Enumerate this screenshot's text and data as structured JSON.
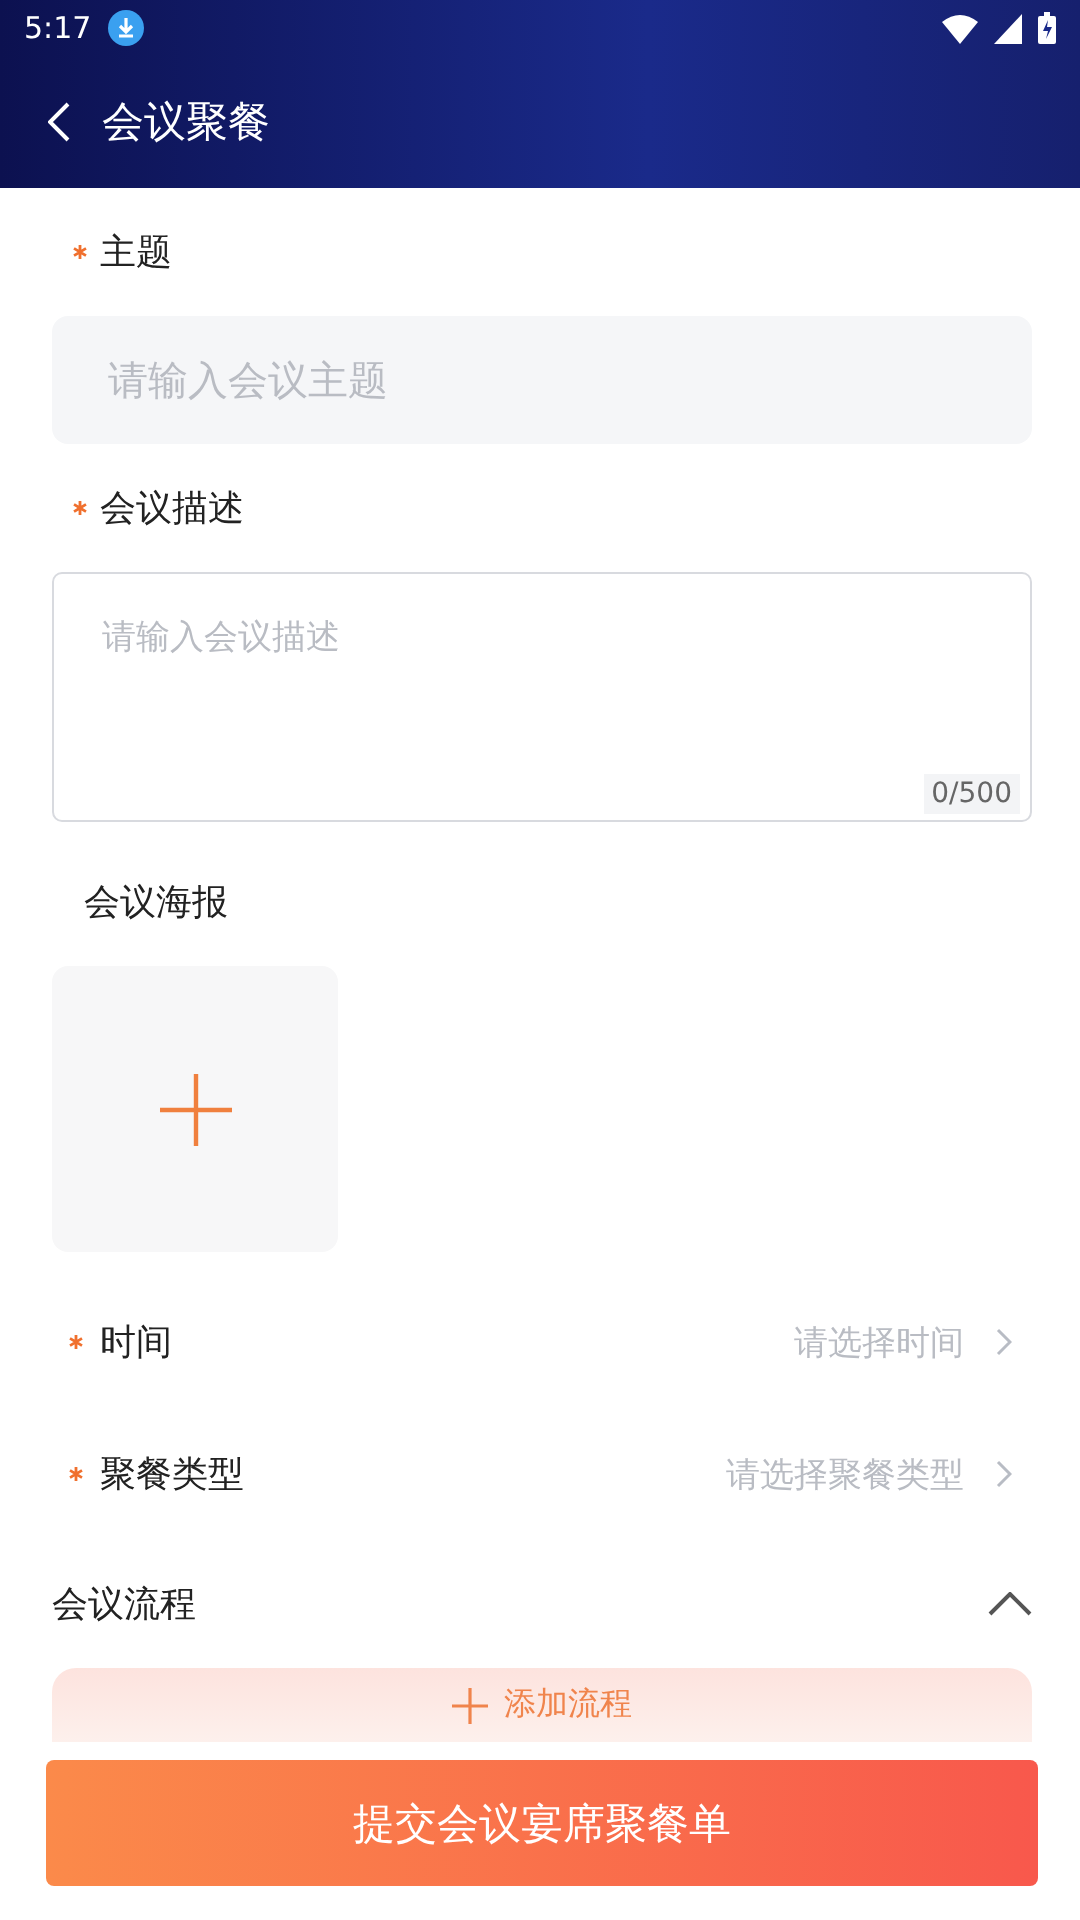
{
  "status_bar": {
    "time": "5:17"
  },
  "header": {
    "title": "会议聚餐"
  },
  "fields": [
    {
      "kind": "input",
      "label": "主题",
      "required": true,
      "placeholder": "请输入会议主题"
    },
    {
      "kind": "textarea",
      "label": "会议描述",
      "required": true,
      "placeholder": "请输入会议描述",
      "counter": "0/500"
    },
    {
      "kind": "upload",
      "label": "会议海报"
    },
    {
      "kind": "select",
      "label": "时间",
      "required": true,
      "placeholder": "请选择时间"
    },
    {
      "kind": "select",
      "label": "聚餐类型",
      "required": true,
      "placeholder": "请选择聚餐类型"
    }
  ],
  "section": {
    "title": "会议流程",
    "expanded": true,
    "add_button": "添加流程"
  },
  "submit_button": "提交会议宴席聚餐单"
}
